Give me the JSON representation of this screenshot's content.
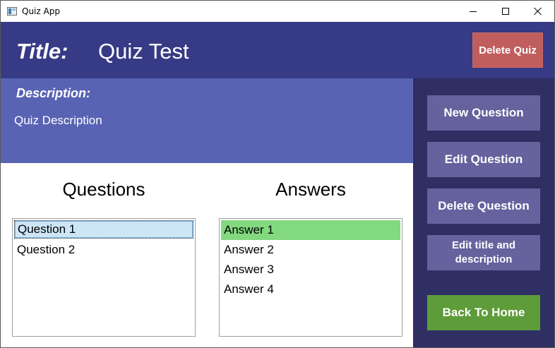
{
  "window": {
    "title": "Quiz App"
  },
  "header": {
    "title_label": "Title:",
    "title_value": "Quiz Test",
    "delete_quiz_label": "Delete Quiz"
  },
  "description": {
    "label": "Description:",
    "value": "Quiz Description"
  },
  "sidebar": {
    "buttons": [
      {
        "label": "New Question"
      },
      {
        "label": "Edit Question"
      },
      {
        "label": "Delete Question"
      },
      {
        "label": "Edit title and description"
      },
      {
        "label": "Back To Home"
      }
    ]
  },
  "questions": {
    "header": "Questions",
    "items": [
      {
        "label": "Question 1",
        "selected": true
      },
      {
        "label": "Question 2",
        "selected": false
      }
    ]
  },
  "answers": {
    "header": "Answers",
    "items": [
      {
        "label": "Answer 1",
        "correct": true
      },
      {
        "label": "Answer 2",
        "correct": false
      },
      {
        "label": "Answer 3",
        "correct": false
      },
      {
        "label": "Answer 4",
        "correct": false
      }
    ]
  },
  "colors": {
    "header_bg": "#373a84",
    "description_bg": "#5863b4",
    "sidebar_bg": "#2f2f64",
    "sidebar_button": "#65629e",
    "delete_button": "#c05e5e",
    "home_button": "#5e9c39",
    "correct_answer": "#83d980",
    "selected_question": "#cde6f6"
  }
}
